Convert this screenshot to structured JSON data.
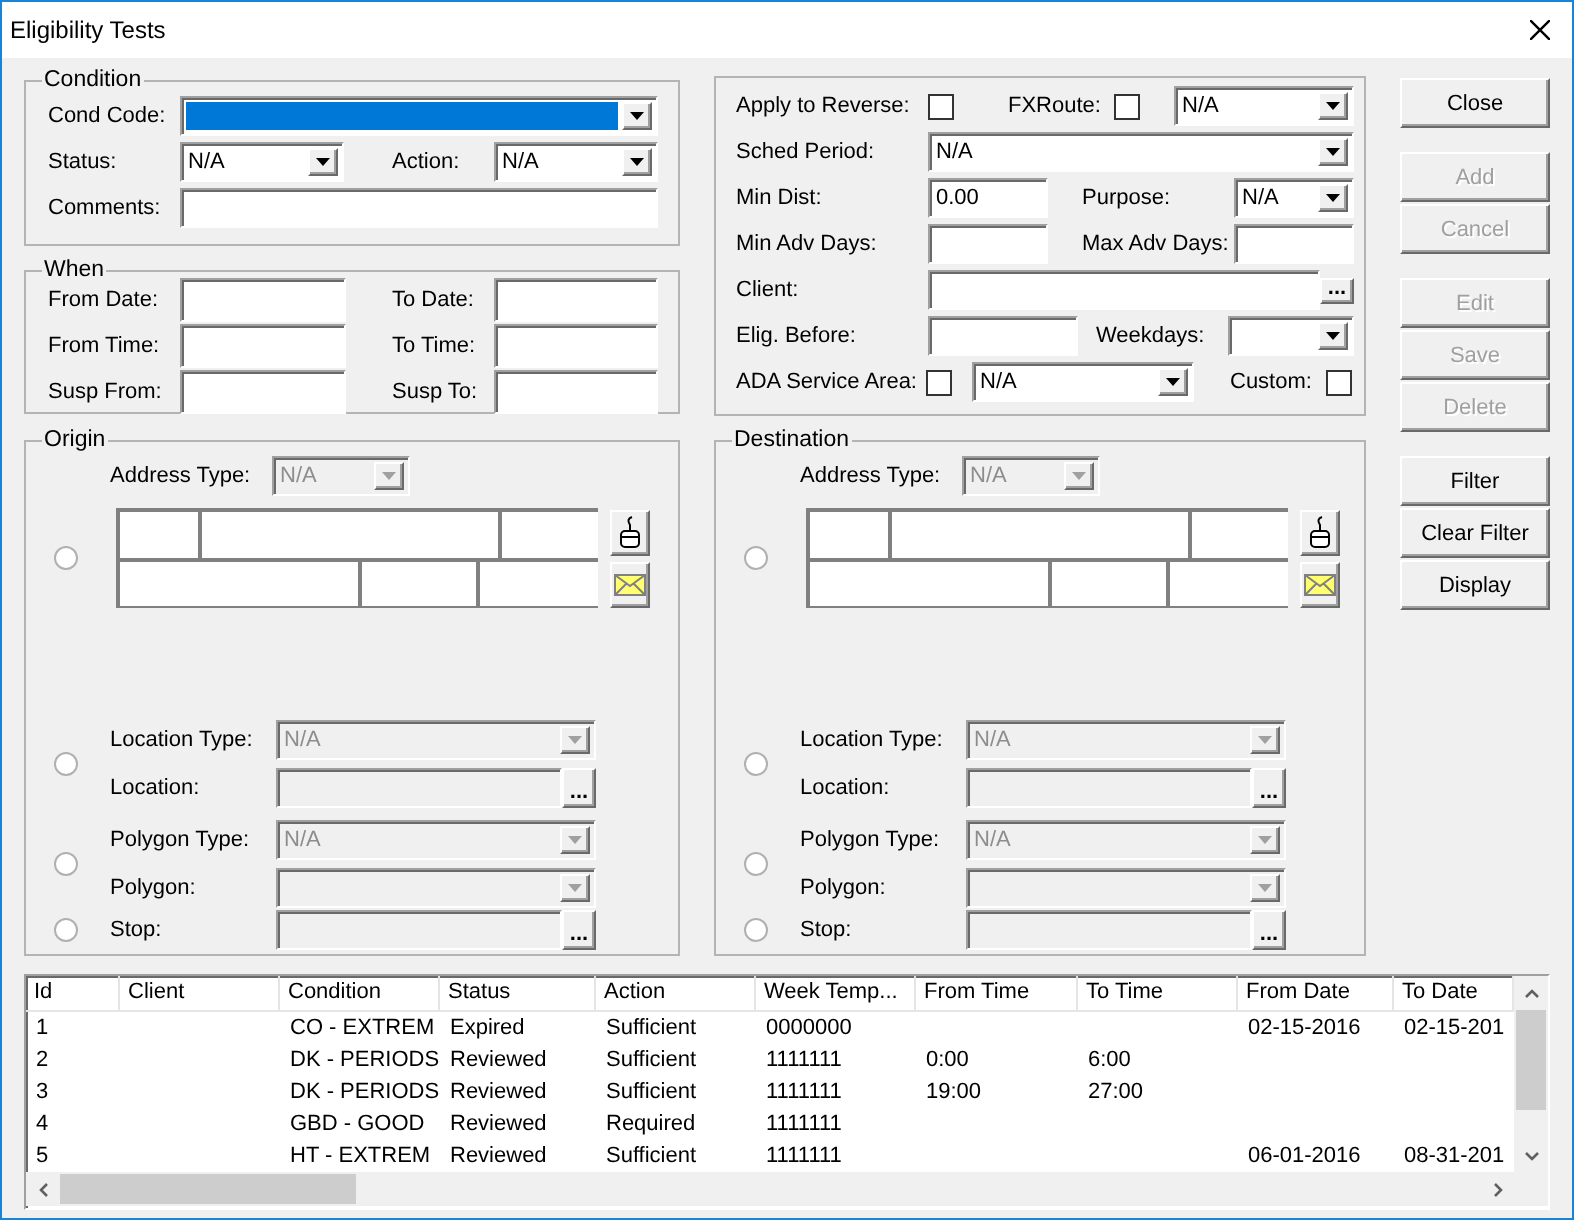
{
  "window": {
    "title": "Eligibility Tests"
  },
  "condition": {
    "legend": "Condition",
    "cond_code": {
      "label": "Cond Code:",
      "highlighted": true
    },
    "status": {
      "label": "Status:",
      "value": "N/A"
    },
    "action": {
      "label": "Action:",
      "value": "N/A"
    },
    "comments": {
      "label": "Comments:"
    }
  },
  "when": {
    "legend": "When",
    "fields": [
      {
        "label": "From Date:"
      },
      {
        "label": "To Date:"
      },
      {
        "label": "From Time:"
      },
      {
        "label": "To Time:"
      },
      {
        "label": "Susp From:"
      },
      {
        "label": "Susp To:"
      }
    ]
  },
  "options": {
    "apply_to_reverse": {
      "label": "Apply to Reverse:",
      "checked": false
    },
    "fxroute": {
      "label": "FXRoute:",
      "checked": false,
      "value": "N/A"
    },
    "sched_period": {
      "label": "Sched Period:",
      "value": "N/A"
    },
    "min_dist": {
      "label": "Min Dist:",
      "value": "0.00"
    },
    "purpose": {
      "label": "Purpose:",
      "value": "N/A"
    },
    "min_adv_days": {
      "label": "Min Adv Days:"
    },
    "max_adv_days": {
      "label": "Max Adv Days:"
    },
    "client": {
      "label": "Client:",
      "browse": "..."
    },
    "elig_before": {
      "label": "Elig. Before:"
    },
    "weekdays": {
      "label": "Weekdays:"
    },
    "ada_service_area": {
      "label": "ADA Service Area:",
      "checked": false,
      "value": "N/A"
    },
    "custom": {
      "label": "Custom:",
      "checked": false
    }
  },
  "button_groups": [
    [
      {
        "label": "Close",
        "disabled": false
      }
    ],
    [
      {
        "label": "Add",
        "disabled": true
      },
      {
        "label": "Cancel",
        "disabled": true
      }
    ],
    [
      {
        "label": "Edit",
        "disabled": true
      },
      {
        "label": "Save",
        "disabled": true
      },
      {
        "label": "Delete",
        "disabled": true
      }
    ],
    [
      {
        "label": "Filter",
        "disabled": false
      },
      {
        "label": "Clear Filter",
        "disabled": false
      },
      {
        "label": "Display",
        "disabled": false
      }
    ]
  ],
  "origin": {
    "legend": "Origin",
    "address": {
      "selected": false,
      "type": {
        "label": "Address Type:",
        "value": "N/A",
        "disabled": true
      }
    },
    "location": {
      "selected": false,
      "type": {
        "label": "Location Type:",
        "value": "N/A",
        "disabled": true
      },
      "field": {
        "label": "Location:",
        "disabled": true,
        "browse": "..."
      }
    },
    "polygon": {
      "selected": false,
      "type": {
        "label": "Polygon Type:",
        "value": "N/A",
        "disabled": true
      },
      "field": {
        "label": "Polygon:",
        "disabled": true
      }
    },
    "stop": {
      "selected": false,
      "field": {
        "label": "Stop:",
        "disabled": true,
        "browse": "..."
      }
    }
  },
  "destination": {
    "legend": "Destination",
    "address": {
      "selected": false,
      "type": {
        "label": "Address Type:",
        "value": "N/A",
        "disabled": true
      }
    },
    "location": {
      "selected": false,
      "type": {
        "label": "Location Type:",
        "value": "N/A",
        "disabled": true
      },
      "field": {
        "label": "Location:",
        "disabled": true,
        "browse": "..."
      }
    },
    "polygon": {
      "selected": false,
      "type": {
        "label": "Polygon Type:",
        "value": "N/A",
        "disabled": true
      },
      "field": {
        "label": "Polygon:",
        "disabled": true
      }
    },
    "stop": {
      "selected": false,
      "field": {
        "label": "Stop:",
        "disabled": true,
        "browse": "..."
      }
    }
  },
  "table": {
    "columns": [
      "Id",
      "Client",
      "Condition",
      "Status",
      "Action",
      "Week Temp...",
      "From Time",
      "To Time",
      "From Date",
      "To Date"
    ],
    "rows": [
      [
        "1",
        null,
        "CO - EXTREM",
        "Expired",
        "Sufficient",
        "0000000",
        null,
        null,
        "02-15-2016",
        "02-15-201"
      ],
      [
        "2",
        null,
        "DK - PERIODS",
        "Reviewed",
        "Sufficient",
        "1111111",
        "0:00",
        "6:00",
        null,
        null
      ],
      [
        "3",
        null,
        "DK - PERIODS",
        "Reviewed",
        "Sufficient",
        "1111111",
        "19:00",
        "27:00",
        null,
        null
      ],
      [
        "4",
        null,
        "GBD - GOOD",
        "Reviewed",
        "Required",
        "1111111",
        null,
        null,
        null,
        null
      ],
      [
        "5",
        null,
        "HT - EXTREM",
        "Reviewed",
        "Sufficient",
        "1111111",
        null,
        null,
        "06-01-2016",
        "08-31-201"
      ]
    ]
  }
}
